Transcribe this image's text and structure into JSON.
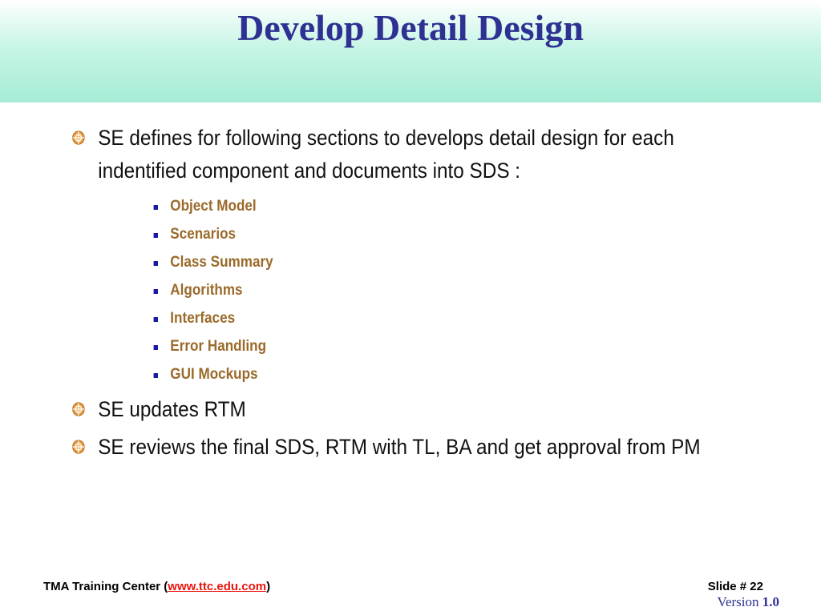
{
  "slide": {
    "title": "Develop Detail Design",
    "bullets": [
      "SE defines for following sections to develops detail design for each indentified component and documents into SDS :",
      "SE updates RTM",
      "SE reviews the final SDS, RTM with TL, BA and get approval from PM"
    ],
    "sub_items": [
      "Object Model",
      "Scenarios",
      "Class Summary",
      "Algorithms",
      "Interfaces",
      "Error Handling",
      "GUI Mockups"
    ]
  },
  "footer": {
    "org_prefix": "TMA Training Center (",
    "link_text": "www.ttc.edu.com",
    "org_suffix": ")",
    "slide_number": "Slide # 22",
    "version_label": "Version",
    "version_number": "1.0"
  },
  "colors": {
    "title": "#2e3192",
    "sub_item": "#9a6a2a",
    "link": "#e8150e",
    "header_gradient": "#a6ecd6"
  }
}
